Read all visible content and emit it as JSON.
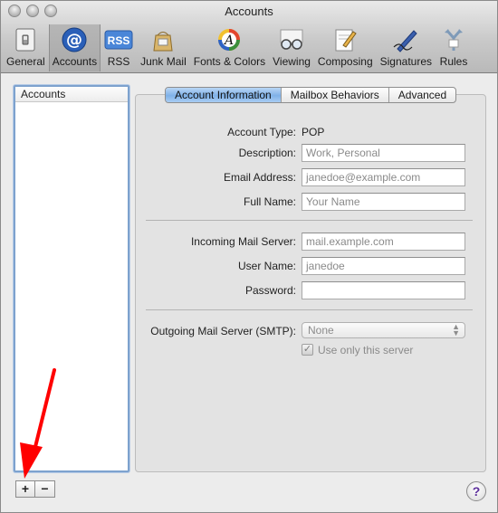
{
  "window": {
    "title": "Accounts"
  },
  "toolbar": {
    "items": [
      {
        "label": "General",
        "icon": "general-switch-icon"
      },
      {
        "label": "Accounts",
        "icon": "at-sign-icon"
      },
      {
        "label": "RSS",
        "icon": "rss-icon"
      },
      {
        "label": "Junk Mail",
        "icon": "junk-mail-bag-icon"
      },
      {
        "label": "Fonts & Colors",
        "icon": "fonts-colors-icon"
      },
      {
        "label": "Viewing",
        "icon": "viewing-glasses-icon"
      },
      {
        "label": "Composing",
        "icon": "composing-pencil-icon"
      },
      {
        "label": "Signatures",
        "icon": "signature-pen-icon"
      },
      {
        "label": "Rules",
        "icon": "rules-arrows-icon"
      }
    ],
    "selected": "Accounts"
  },
  "accounts_list": {
    "header": "Accounts"
  },
  "list_buttons": {
    "add": "+",
    "remove": "−"
  },
  "tabs": [
    "Account Information",
    "Mailbox Behaviors",
    "Advanced"
  ],
  "active_tab": "Account Information",
  "form": {
    "account_type_label": "Account Type:",
    "account_type_value": "POP",
    "description_label": "Description:",
    "description_placeholder": "Work, Personal",
    "email_label": "Email Address:",
    "email_placeholder": "janedoe@example.com",
    "fullname_label": "Full Name:",
    "fullname_placeholder": "Your Name",
    "incoming_label": "Incoming Mail Server:",
    "incoming_placeholder": "mail.example.com",
    "username_label": "User Name:",
    "username_placeholder": "janedoe",
    "password_label": "Password:",
    "password_value": "",
    "smtp_label": "Outgoing Mail Server (SMTP):",
    "smtp_value": "None",
    "use_only_label": "Use only this server",
    "use_only_checked": true
  },
  "help": {
    "label": "?"
  },
  "colors": {
    "annotation_arrow": "#ff0000",
    "tab_active": "#7fb1e8",
    "list_border": "#7da2ce"
  }
}
